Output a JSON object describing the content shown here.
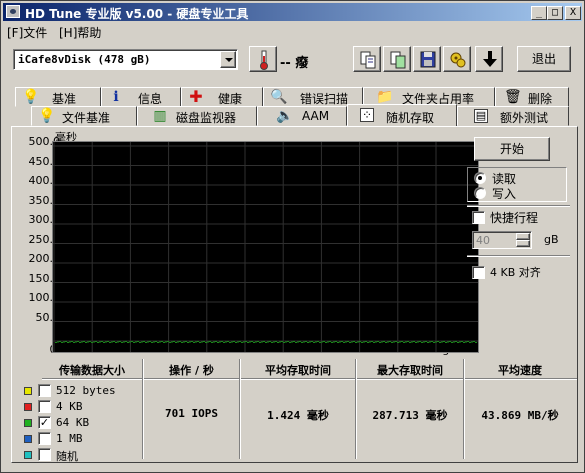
{
  "window": {
    "title": "HD Tune 专业版 v5.00 - 硬盘专业工具",
    "controls": {
      "minimize": "_",
      "maximize": "□",
      "close": "X"
    }
  },
  "menu": {
    "file": "[F]文件",
    "help": "[H]帮助"
  },
  "toolbar": {
    "drive": "iCafe8vDisk (478 gB)",
    "temperature": "-- 癈",
    "exit_label": "退出",
    "icons": [
      "thermometer-icon",
      "copy-text-icon",
      "copy-screenshot-icon",
      "save-icon",
      "options-icon",
      "download-icon"
    ]
  },
  "tabs": {
    "row1": [
      {
        "label": "基准",
        "icon": "lightbulb-icon"
      },
      {
        "label": "信息",
        "icon": "info-icon"
      },
      {
        "label": "健康",
        "icon": "health-cross-icon"
      },
      {
        "label": "错误扫描",
        "icon": "magnifier-icon"
      },
      {
        "label": "文件夹占用率",
        "icon": "folder-icon"
      },
      {
        "label": "删除",
        "icon": "trash-icon"
      }
    ],
    "row2": [
      {
        "label": "文件基准",
        "icon": "file-bench-icon"
      },
      {
        "label": "磁盘监视器",
        "icon": "monitor-chart-icon"
      },
      {
        "label": "AAM",
        "icon": "speaker-icon"
      },
      {
        "label": "随机存取",
        "icon": "random-access-icon",
        "active": true
      },
      {
        "label": "额外测试",
        "icon": "extra-tests-icon"
      }
    ]
  },
  "graph": {
    "y_unit": "毫秒",
    "y_ticks": [
      "500.0",
      "450.0",
      "400.0",
      "350.0",
      "300.0",
      "250.0",
      "200.0",
      "150.0",
      "100.0",
      "50.0"
    ],
    "x_ticks": [
      "0",
      "47",
      "95",
      "143",
      "191",
      "239",
      "286",
      "334",
      "382",
      "430",
      "478gB"
    ],
    "series_color": "#1a8a1a"
  },
  "controls": {
    "start_label": "开始",
    "read_label": "读取",
    "write_label": "写入",
    "read_selected": true,
    "shortstroke_label": "快捷行程",
    "shortstroke_value": "40",
    "shortstroke_unit": "gB",
    "align_label": "4 KB 对齐"
  },
  "stats": {
    "headers": {
      "size": "传输数据大小",
      "ops": "操作 / 秒",
      "avg_access": "平均存取时间",
      "max_access": "最大存取时间",
      "avg_speed": "平均速度"
    },
    "sizes": [
      {
        "label": "512 bytes",
        "color": "#e6e600",
        "checked": false
      },
      {
        "label": "4 KB",
        "color": "#e02020",
        "checked": false
      },
      {
        "label": "64 KB",
        "color": "#20b020",
        "checked": true
      },
      {
        "label": "1 MB",
        "color": "#2060c0",
        "checked": false
      },
      {
        "label": "随机",
        "color": "#20c0c0",
        "checked": false
      }
    ],
    "result": {
      "ops": "701 IOPS",
      "avg_access": "1.424 毫秒",
      "max_access": "287.713 毫秒",
      "avg_speed": "43.869 MB/秒"
    }
  }
}
